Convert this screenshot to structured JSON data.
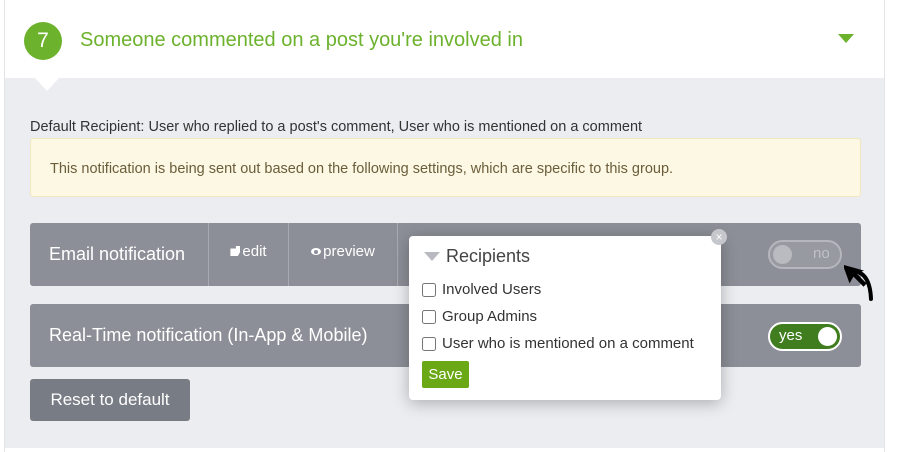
{
  "header": {
    "step_number": "7",
    "title": "Someone commented on a post you're involved in"
  },
  "default_recipient": "Default Recipient: User who replied to a post's comment, User who is mentioned on a comment",
  "notice": "This notification is being sent out based on the following settings, which are specific to this group.",
  "email_row": {
    "label": "Email notification",
    "edit_label": "edit",
    "preview_label": "preview",
    "toggle_label": "no",
    "toggle_on": false
  },
  "realtime_row": {
    "label": "Real-Time notification (In-App & Mobile)",
    "toggle_label": "yes",
    "toggle_on": true
  },
  "reset_label": "Reset to default",
  "popup": {
    "title": "Recipients",
    "options": [
      {
        "label": "Involved Users",
        "checked": false
      },
      {
        "label": "Group Admins",
        "checked": false
      },
      {
        "label": "User who is mentioned on a comment",
        "checked": false
      }
    ],
    "save_label": "Save"
  },
  "colors": {
    "accent": "#6cb22d",
    "row_bg": "#8c8f97",
    "toggle_on": "#3f7d1e",
    "save_bg": "#6aa815"
  },
  "icons": [
    "caret-down-icon",
    "pencil-icon",
    "eye-icon",
    "close-icon",
    "chevron-down-icon",
    "cursor-icon"
  ]
}
